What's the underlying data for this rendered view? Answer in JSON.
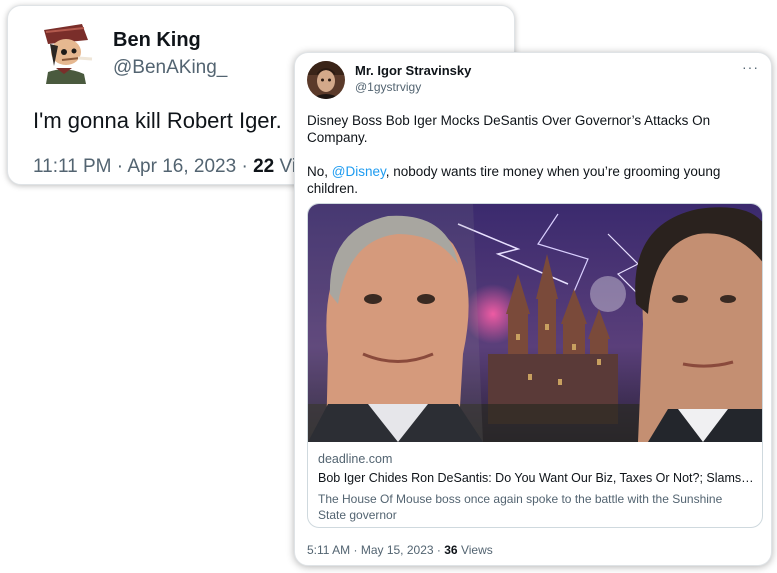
{
  "tweet1": {
    "display_name": "Ben King",
    "handle": "@BenAKing_",
    "text": "I'm gonna kill Robert Iger.",
    "time": "11:11 PM",
    "date": "Apr 16, 2023",
    "views_count": "22",
    "views_label": "Vie"
  },
  "tweet2": {
    "display_name": "Mr. Igor Stravinsky",
    "handle": "@1gystrvigy",
    "more_icon": "more-horizontal-icon",
    "paragraph1": "Disney Boss Bob Iger Mocks DeSantis Over Governor’s Attacks On Company.",
    "p2_prefix": "No, ",
    "p2_mention": "@Disney",
    "p2_suffix": ", nobody wants tire money when you’re grooming young children.",
    "link_card": {
      "domain": "deadline.com",
      "title": "Bob Iger Chides Ron DeSantis: Do You Want Our Biz, Taxes Or Not?; Slams Florida Governor",
      "description": "The House Of Mouse boss once again spoke to the battle with the Sunshine State governor"
    },
    "time": "5:11 AM",
    "date": "May 15, 2023",
    "views_count": "36",
    "views_label": "Views"
  },
  "colors": {
    "link": "#1d9bf0",
    "secondary_text": "#536471",
    "primary_text": "#0f1419"
  }
}
